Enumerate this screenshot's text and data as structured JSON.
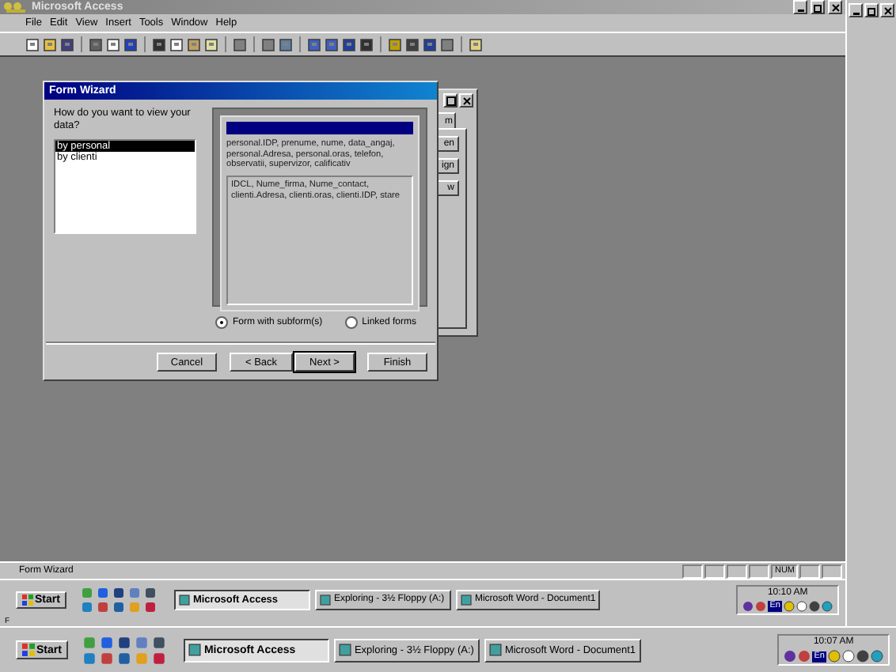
{
  "app": {
    "title": "Microsoft Access",
    "menu": [
      "File",
      "Edit",
      "View",
      "Insert",
      "Tools",
      "Window",
      "Help"
    ]
  },
  "database_window": {
    "tab": "m",
    "buttons": [
      "en",
      "ign",
      "w"
    ]
  },
  "wizard": {
    "title": "Form Wizard",
    "question": "How do you want to view your data?",
    "options": [
      {
        "label": "by personal",
        "selected": true
      },
      {
        "label": "by clienti",
        "selected": false
      }
    ],
    "main_fields": "personal.IDP, prenume, nume, data_angaj, personal.Adresa, personal.oras, telefon, observatii, supervizor, calificativ",
    "sub_fields": "IDCL, Nume_firma, Nume_contact, clienti.Adresa, clienti.oras, clienti.IDP, stare",
    "layouts": [
      {
        "label": "Form with subform(s)",
        "selected": true
      },
      {
        "label": "Linked forms",
        "selected": false
      }
    ],
    "buttons": [
      "Cancel",
      "< Back",
      "Next >",
      "Finish"
    ]
  },
  "status_bar": {
    "text": "Form Wizard",
    "indicator": "NUM"
  },
  "inner_taskbar": {
    "start": "Start",
    "tasks": [
      {
        "label": "Microsoft Access",
        "selected": true
      },
      {
        "label": "Exploring - 3½ Floppy (A:)",
        "selected": false
      },
      {
        "label": "Microsoft Word - Document1",
        "selected": false
      }
    ],
    "language": "En",
    "clock": "10:10 AM"
  },
  "strip_text": "F",
  "taskbar": {
    "start": "Start",
    "tasks": [
      {
        "label": "Microsoft Access",
        "selected": true
      },
      {
        "label": "Exploring - 3½ Floppy (A:)",
        "selected": false
      },
      {
        "label": "Microsoft Word - Document1",
        "selected": false
      }
    ],
    "language": "En",
    "clock": "10:07 AM"
  }
}
